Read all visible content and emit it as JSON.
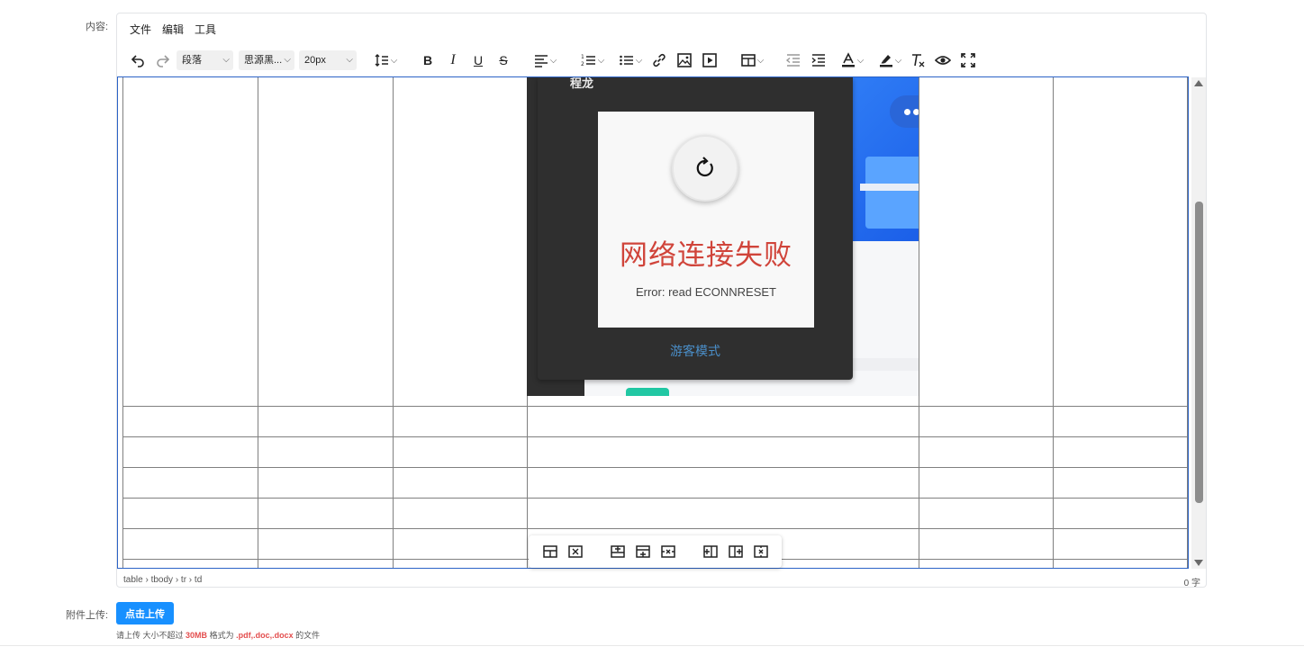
{
  "form": {
    "content_label": "内容:",
    "attachment_label": "附件上传:",
    "upload_button": "点击上传",
    "hint_prefix": "请上传 大小不超过",
    "hint_size": "30MB",
    "hint_mid": "格式为",
    "hint_formats": ".pdf,.doc,.docx",
    "hint_suffix": "的文件"
  },
  "editor": {
    "menu": [
      "文件",
      "编辑",
      "工具"
    ],
    "toolbar": {
      "block_format": "段落",
      "font_family": "思源黑...",
      "font_size": "20px"
    },
    "statusbar": {
      "path": "table › tbody › tr › td",
      "word_count": "0 字"
    }
  },
  "embedded_page": {
    "header_fragment": "程龙",
    "error_title": "网络连接失败",
    "error_message": "Error: read ECONNRESET",
    "guest_link": "游客模式"
  },
  "icons": {
    "toolbar": [
      "undo-icon",
      "redo-icon",
      "line-height-icon",
      "bold-icon",
      "italic-icon",
      "underline-icon",
      "strikethrough-icon",
      "align-icon",
      "numbered-list-icon",
      "bullet-list-icon",
      "link-icon",
      "image-icon",
      "media-icon",
      "table-icon",
      "outdent-icon",
      "indent-icon",
      "text-color-icon",
      "highlight-color-icon",
      "clear-format-icon",
      "preview-icon",
      "fullscreen-icon"
    ],
    "table_toolbar": [
      "table-properties-icon",
      "delete-table-icon",
      "insert-row-before-icon",
      "insert-row-after-icon",
      "delete-row-icon",
      "insert-col-before-icon",
      "insert-col-after-icon",
      "delete-col-icon"
    ]
  },
  "colors": {
    "accent": "#1890ff",
    "focus_border": "#2b63c7",
    "error_red": "#d0443a",
    "hint_red": "#e34d4d"
  }
}
